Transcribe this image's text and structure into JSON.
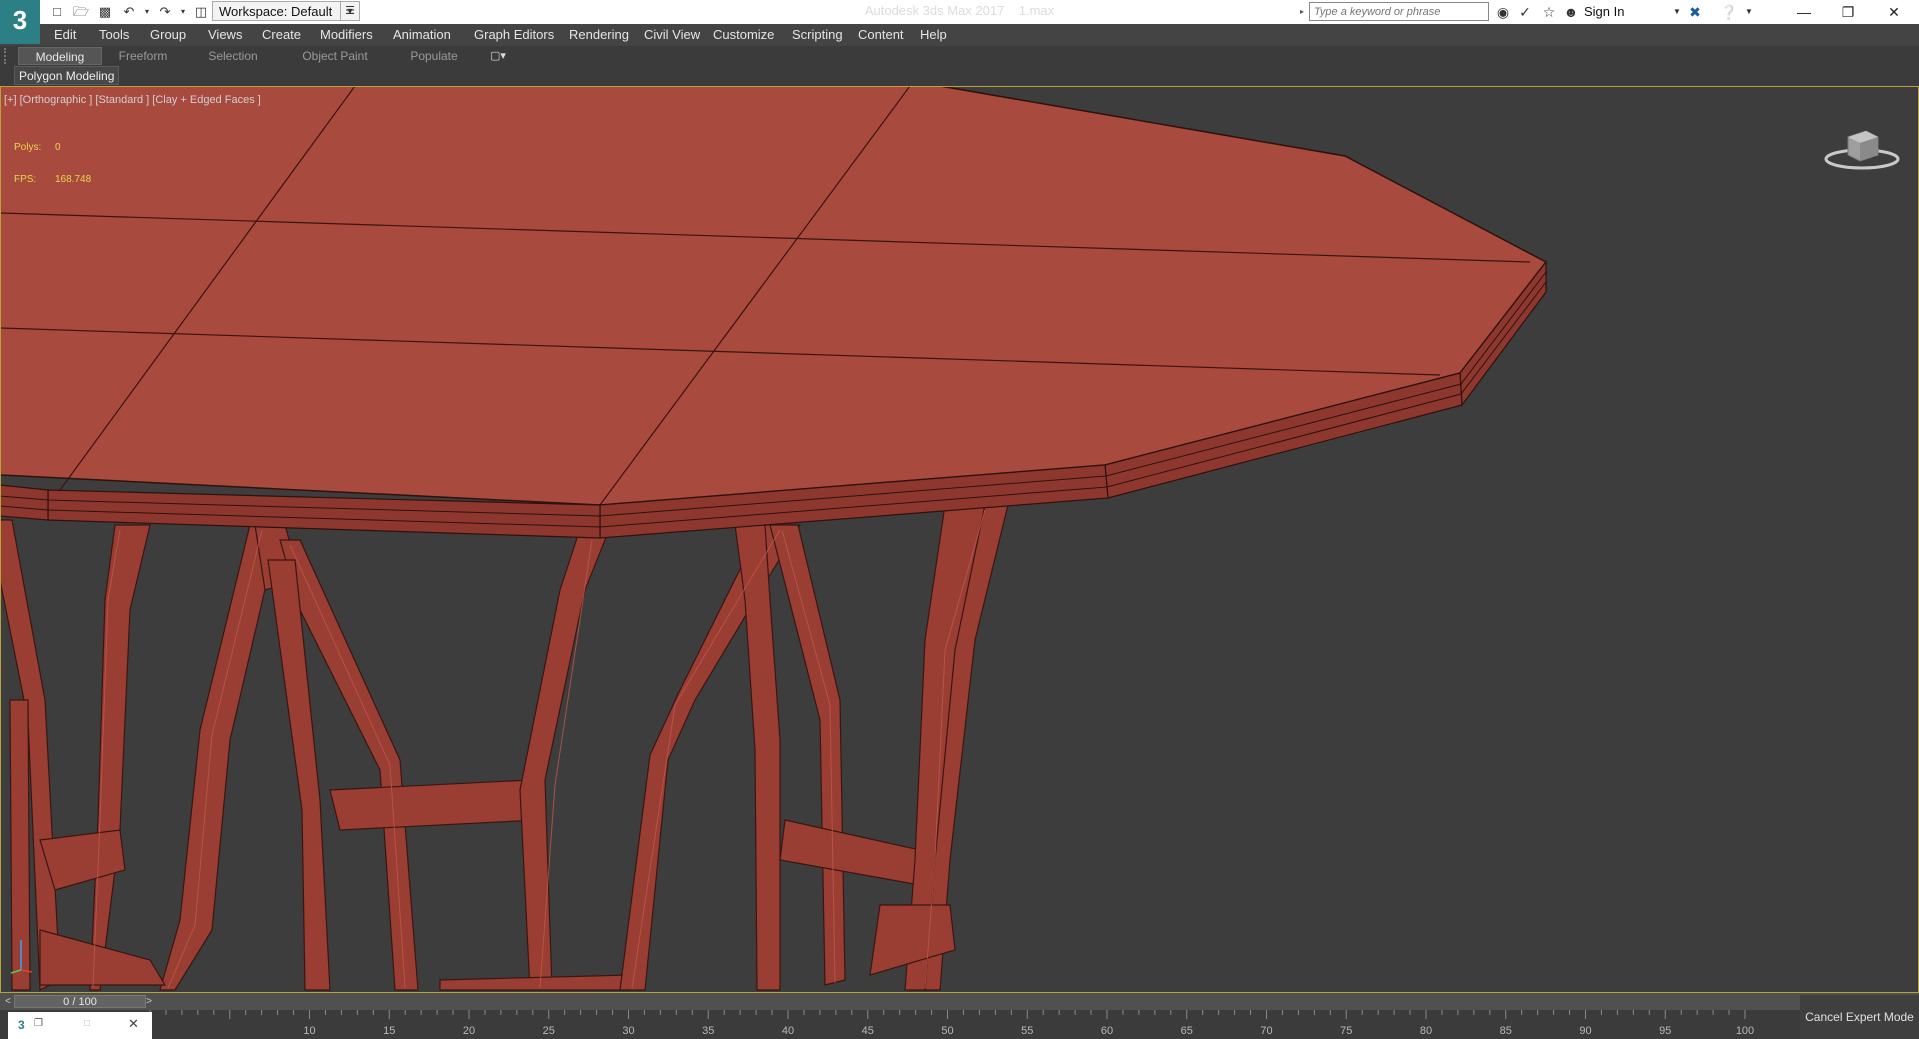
{
  "titlebar": {
    "app_title": "Autodesk 3ds Max 2017",
    "file_name": "1.max",
    "logo_glyph": "3",
    "workspace_label": "Workspace: Default",
    "search_placeholder": "Type a keyword or phrase",
    "sign_in_label": "Sign In",
    "icons": [
      "new-file-icon",
      "open-file-icon",
      "save-icon",
      "undo-icon",
      "redo-icon",
      "project-folder-icon",
      "binoculars-icon",
      "communication-icon",
      "star-icon",
      "user-icon",
      "exchange-icon",
      "help-icon",
      "minimize-icon",
      "restore-icon",
      "close-icon"
    ]
  },
  "menu": {
    "items": [
      "Edit",
      "Tools",
      "Group",
      "Views",
      "Create",
      "Modifiers",
      "Animation",
      "Graph Editors",
      "Rendering",
      "Civil View",
      "Customize",
      "Scripting",
      "Content",
      "Help"
    ]
  },
  "ribbon": {
    "tabs": [
      "Modeling",
      "Freeform",
      "Selection",
      "Object Paint",
      "Populate"
    ],
    "active_tab": "Modeling",
    "panel_label": "Polygon Modeling"
  },
  "viewport": {
    "label": "[+] [Orthographic ] [Standard ] [Clay + Edged Faces ]",
    "polys_label": "Polys:",
    "polys_value": "0",
    "fps_label": "FPS:",
    "fps_value": "168.748",
    "border_color": "#b8a23a",
    "model_color": "#a94a3f"
  },
  "timeline": {
    "frame_readout": "0 / 100",
    "current_frame": 0,
    "total_frames": 100,
    "ticks": [
      "10",
      "15",
      "20",
      "25",
      "30",
      "35",
      "40",
      "45",
      "50",
      "55",
      "60",
      "65",
      "70",
      "75",
      "80",
      "85",
      "90",
      "95",
      "100"
    ],
    "cancel_expert_label": "Cancel Expert Mode"
  }
}
